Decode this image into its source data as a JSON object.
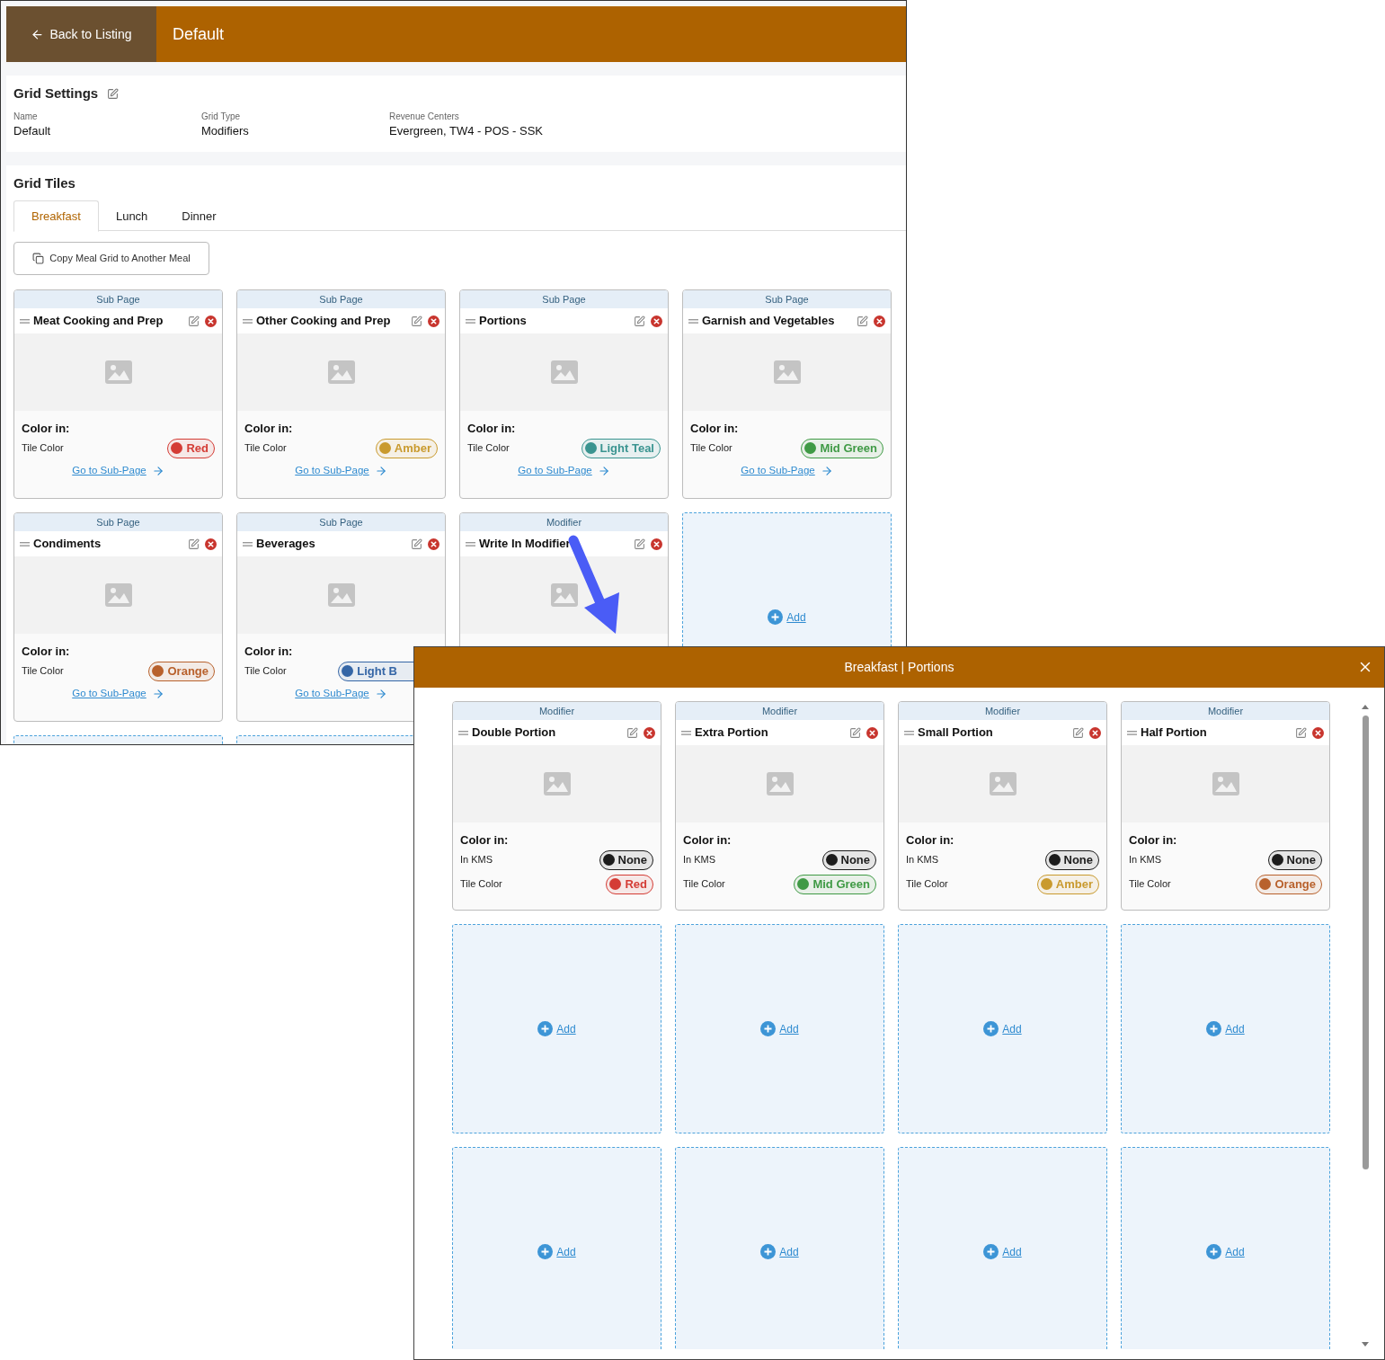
{
  "header": {
    "back_button": "Back to Listing",
    "title": "Default"
  },
  "grid_settings": {
    "title": "Grid Settings",
    "fields": [
      {
        "label": "Name",
        "value": "Default"
      },
      {
        "label": "Grid Type",
        "value": "Modifiers"
      },
      {
        "label": "Revenue Centers",
        "value": "Evergreen, TW4 - POS - SSK"
      }
    ]
  },
  "grid_tiles": {
    "title": "Grid Tiles",
    "tabs": [
      {
        "label": "Breakfast",
        "selected": true
      },
      {
        "label": "Lunch",
        "selected": false
      },
      {
        "label": "Dinner",
        "selected": false
      }
    ],
    "copy_button": "Copy Meal Grid to Another Meal",
    "tiles": [
      {
        "kind": "tile",
        "type": "Sub Page",
        "title": "Meat Cooking and Prep",
        "color_heading": "Color in:",
        "colors": [
          {
            "label": "Tile Color",
            "value": "Red",
            "color": "#d43c35"
          }
        ],
        "link": "Go to Sub-Page"
      },
      {
        "kind": "tile",
        "type": "Sub Page",
        "title": "Other Cooking and Prep",
        "color_heading": "Color in:",
        "colors": [
          {
            "label": "Tile Color",
            "value": "Amber",
            "color": "#c99a2e"
          }
        ],
        "link": "Go to Sub-Page"
      },
      {
        "kind": "tile",
        "type": "Sub Page",
        "title": "Portions",
        "color_heading": "Color in:",
        "colors": [
          {
            "label": "Tile Color",
            "value": "Light Teal",
            "color": "#3a9490"
          }
        ],
        "link": "Go to Sub-Page"
      },
      {
        "kind": "tile",
        "type": "Sub Page",
        "title": "Garnish and Vegetables",
        "color_heading": "Color in:",
        "colors": [
          {
            "label": "Tile Color",
            "value": "Mid Green",
            "color": "#3f9a45"
          }
        ],
        "link": "Go to Sub-Page"
      },
      {
        "kind": "tile",
        "type": "Sub Page",
        "title": "Condiments",
        "color_heading": "Color in:",
        "colors": [
          {
            "label": "Tile Color",
            "value": "Orange",
            "color": "#b8612c"
          }
        ],
        "link": "Go to Sub-Page"
      },
      {
        "kind": "tile",
        "type": "Sub Page",
        "title": "Beverages",
        "color_heading": "Color in:",
        "colors": [
          {
            "label": "Tile Color",
            "value": "Light B",
            "color": "#3566a6"
          }
        ],
        "link": "Go to Sub-Page"
      },
      {
        "kind": "tile",
        "type": "Modifier",
        "title": "Write In Modifier"
      },
      {
        "kind": "add",
        "label": "Add"
      },
      {
        "kind": "add"
      },
      {
        "kind": "add"
      }
    ]
  },
  "dialog": {
    "title": "Breakfast | Portions",
    "tiles": [
      {
        "kind": "tile",
        "type": "Modifier",
        "title": "Double Portion",
        "color_heading": "Color in:",
        "colors": [
          {
            "label": "In KMS",
            "value": "None",
            "color": "#1c1c1c"
          },
          {
            "label": "Tile Color",
            "value": "Red",
            "color": "#d43c35"
          }
        ]
      },
      {
        "kind": "tile",
        "type": "Modifier",
        "title": "Extra Portion",
        "color_heading": "Color in:",
        "colors": [
          {
            "label": "In KMS",
            "value": "None",
            "color": "#1c1c1c"
          },
          {
            "label": "Tile Color",
            "value": "Mid Green",
            "color": "#3f9a45"
          }
        ]
      },
      {
        "kind": "tile",
        "type": "Modifier",
        "title": "Small Portion",
        "color_heading": "Color in:",
        "colors": [
          {
            "label": "In KMS",
            "value": "None",
            "color": "#1c1c1c"
          },
          {
            "label": "Tile Color",
            "value": "Amber",
            "color": "#c99a2e"
          }
        ]
      },
      {
        "kind": "tile",
        "type": "Modifier",
        "title": "Half Portion",
        "color_heading": "Color in:",
        "colors": [
          {
            "label": "In KMS",
            "value": "None",
            "color": "#1c1c1c"
          },
          {
            "label": "Tile Color",
            "value": "Orange",
            "color": "#b8612c"
          }
        ]
      },
      {
        "kind": "add",
        "label": "Add"
      },
      {
        "kind": "add",
        "label": "Add"
      },
      {
        "kind": "add",
        "label": "Add"
      },
      {
        "kind": "add",
        "label": "Add"
      },
      {
        "kind": "add",
        "label": "Add"
      },
      {
        "kind": "add",
        "label": "Add"
      },
      {
        "kind": "add",
        "label": "Add"
      },
      {
        "kind": "add",
        "label": "Add"
      }
    ]
  }
}
